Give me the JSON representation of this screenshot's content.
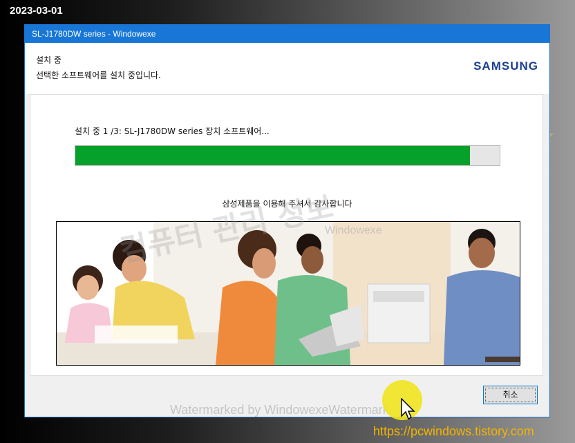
{
  "overlay": {
    "date": "2023-03-01",
    "blog_url": "https://pcwindows.tistory.com",
    "watermark_text": "Watermarked by WindowexeWatermark",
    "watermark_center": "컴퓨터 관리 정보",
    "watermark_mid": "Windowexe"
  },
  "window": {
    "title": "SL-J1780DW series   - Windowexe"
  },
  "header": {
    "title": "설치 중",
    "subtitle": "선택한 소프트웨어를 설치 중입니다.",
    "brand": "SAMSUNG"
  },
  "install": {
    "status": "설치 중 1 /3: SL-J1780DW series 장치 소프트웨어...",
    "progress": 0.93,
    "thanks": "삼성제품을 이용해 주셔서 감사합니다"
  },
  "buttons": {
    "cancel": "취소"
  },
  "colors": {
    "titlebar": "#1877d6",
    "progress_fill": "#06a12b",
    "brand": "#1b3f8f",
    "url": "#f4b400"
  }
}
